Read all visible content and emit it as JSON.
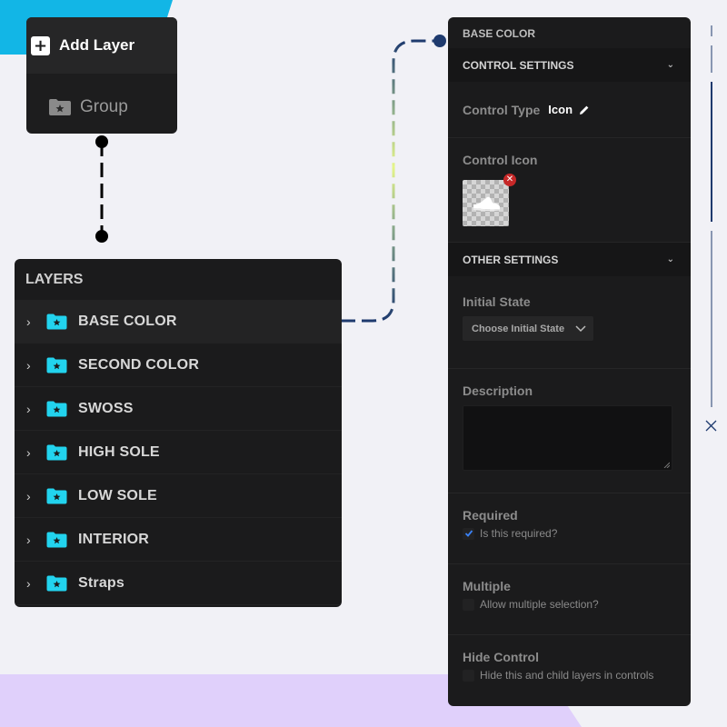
{
  "add_panel": {
    "title": "Add Layer",
    "plus_icon": "plus-icon",
    "group_label": "Group",
    "group_icon": "folder-star-icon"
  },
  "layers_panel": {
    "title": "LAYERS",
    "items": [
      {
        "label": "BASE COLOR",
        "active": true
      },
      {
        "label": "SECOND COLOR"
      },
      {
        "label": "SWOSS"
      },
      {
        "label": "HIGH SOLE"
      },
      {
        "label": "LOW SOLE"
      },
      {
        "label": "INTERIOR"
      },
      {
        "label": "Straps"
      }
    ],
    "item_icon": "folder-star-icon",
    "folder_color": "#22d3ee"
  },
  "settings_panel": {
    "title": "BASE COLOR",
    "control_settings": {
      "header": "CONTROL SETTINGS",
      "control_type_label": "Control Type",
      "control_type_value": "Icon",
      "control_icon_label": "Control Icon"
    },
    "other_settings": {
      "header": "OTHER SETTINGS",
      "initial_state_label": "Initial State",
      "initial_state_placeholder": "Choose Initial State",
      "description_label": "Description",
      "description_value": "",
      "required_label": "Required",
      "required_checkbox": "Is this required?",
      "required_checked": true,
      "multiple_label": "Multiple",
      "multiple_checkbox": "Allow multiple selection?",
      "multiple_checked": false,
      "hide_label": "Hide Control",
      "hide_checkbox": "Hide this and child layers in controls",
      "hide_checked": false
    }
  },
  "colors": {
    "accent_cyan": "#22d3ee",
    "connector": "#1e3a6e",
    "check_blue": "#3b82f6",
    "remove_red": "#c62828"
  }
}
